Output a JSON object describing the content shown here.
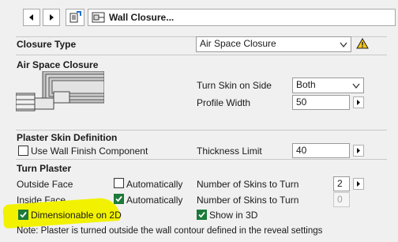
{
  "toolbar": {
    "title": "Wall Closure..."
  },
  "closure_type": {
    "label": "Closure Type",
    "value": "Air Space Closure"
  },
  "air_space": {
    "heading": "Air Space Closure",
    "turn_skin_label": "Turn Skin on Side",
    "turn_skin_value": "Both",
    "profile_width_label": "Profile Width",
    "profile_width_value": "50"
  },
  "plaster_skin": {
    "heading": "Plaster Skin Definition",
    "use_finish_label": "Use Wall Finish Component",
    "thickness_label": "Thickness Limit",
    "thickness_value": "40"
  },
  "turn_plaster": {
    "heading": "Turn Plaster",
    "outside_label": "Outside Face",
    "inside_label": "Inside Face",
    "auto_label": "Automatically",
    "skins_label": "Number of Skins to Turn",
    "outside_skins_value": "2",
    "inside_skins_value": "0",
    "dimensionable_label": "Dimensionable on 2D",
    "show3d_label": "Show in 3D",
    "note": "Note: Plaster is turned outside the wall contour defined in the reveal settings"
  },
  "colors": {
    "highlight": "#f2f200",
    "check_green": "#1b7a3a",
    "warning_yellow": "#f5c518"
  }
}
